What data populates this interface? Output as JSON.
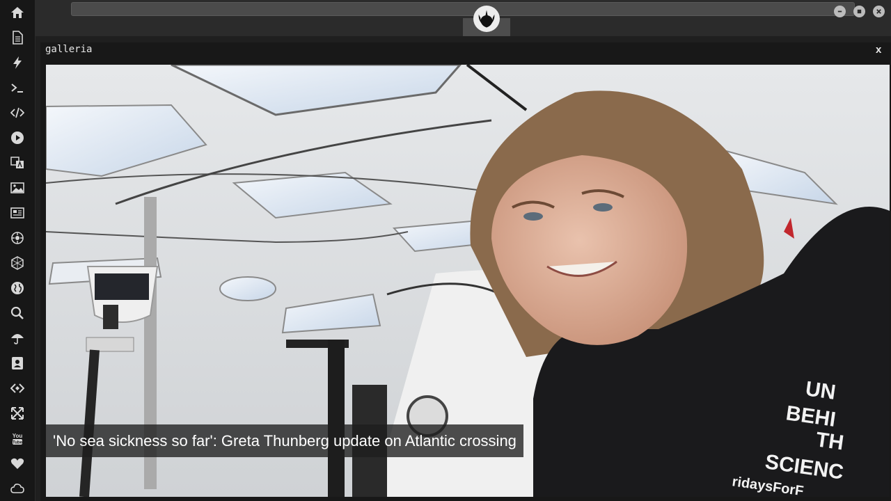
{
  "window": {
    "tab_icon": "rebel-alliance-emblem-icon",
    "controls": [
      "minimize-icon",
      "maximize-icon",
      "close-icon"
    ]
  },
  "sidebar": {
    "icons": [
      "home-icon",
      "document-icon",
      "lightning-icon",
      "terminal-icon",
      "code-icon",
      "play-icon",
      "translate-icon",
      "image-icon",
      "news-icon",
      "settings-cog-icon",
      "hexagon-icon",
      "globe-icon",
      "search-icon",
      "umbrella-icon",
      "contact-card-icon",
      "code-diamond-icon",
      "expand-icon",
      "youtube-icon",
      "heart-icon",
      "cloud-icon"
    ]
  },
  "panel": {
    "title": "galleria",
    "close_label": "x"
  },
  "gallery": {
    "caption": "'No sea sickness so far': Greta Thunberg update on Atlantic crossing",
    "image_subject": "smiling girl in black jacket inside boat cabin",
    "jacket_text": [
      "UN",
      "BEHI",
      "TH",
      "SCIENC",
      "ridaysForF"
    ]
  },
  "colors": {
    "background": "#1f1f1f",
    "sidebar": "#171717",
    "topbar": "#2b2b2b",
    "tab": "#4d4d4d",
    "caption_bg": "#1e1e1e"
  }
}
